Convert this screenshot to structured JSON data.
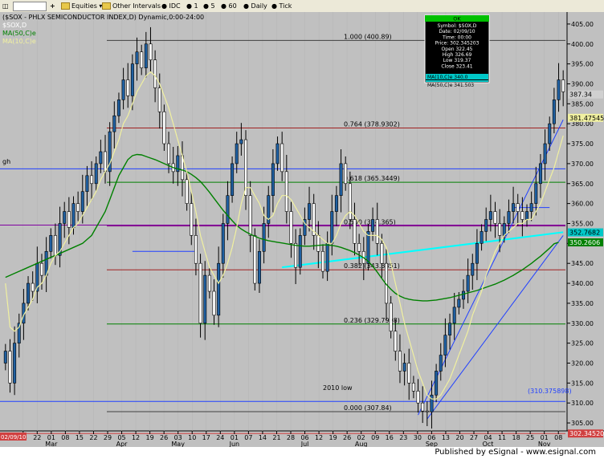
{
  "toolbar": {
    "save_icon": "floppy-icon",
    "symbol_box": "",
    "plus": "+",
    "equities": "Equities",
    "other_intervals": "Other Intervals",
    "idc": "IDC",
    "i1": "1",
    "i5": "5",
    "i60": "60",
    "daily": "Daily",
    "tick": "Tick"
  },
  "footer": {
    "published": "Published by eSignal - www.esignal.com"
  },
  "colors": {
    "bg": "#c0c0c0",
    "up": "#1f5fa0",
    "down": "#000000",
    "ma10": "#f0f0a0",
    "ma50": "#008000",
    "cyan": "#00ffff",
    "channel": "#2040ff"
  },
  "chart_data": {
    "type": "candlestick",
    "title": "($SOX - PHLX SEMICONDUCTOR INDEX,D) Dynamic,0:00-24:00",
    "legend": [
      {
        "label": "MA(50,C)e",
        "color": "#008000"
      },
      {
        "label": "MA(10,C)e",
        "color": "#f0f0a0"
      }
    ],
    "ylim": [
      303,
      408
    ],
    "y_ticks": [
      305,
      310,
      315,
      320,
      325,
      330,
      335,
      340,
      345,
      350,
      355,
      360,
      365,
      370,
      375,
      380,
      385,
      390,
      395,
      400,
      405
    ],
    "x_day_labels": [
      "15",
      "22",
      "01",
      "08",
      "15",
      "22",
      "29",
      "05",
      "12",
      "19",
      "26",
      "03",
      "10",
      "17",
      "24",
      "01",
      "07",
      "14",
      "21",
      "28",
      "06",
      "12",
      "19",
      "26",
      "02",
      "09",
      "16",
      "23",
      "30",
      "06",
      "13",
      "20",
      "27",
      "04",
      "11",
      "18",
      "25",
      "01",
      "08"
    ],
    "x_month_labels": [
      {
        "label": "Mar",
        "index": 2
      },
      {
        "label": "Apr",
        "index": 7
      },
      {
        "label": "May",
        "index": 11
      },
      {
        "label": "Jun",
        "index": 15
      },
      {
        "label": "Jul",
        "index": 20
      },
      {
        "label": "Aug",
        "index": 24
      },
      {
        "label": "Sep",
        "index": 29
      },
      {
        "label": "Oct",
        "index": 33
      },
      {
        "label": "Nov",
        "index": 37
      }
    ],
    "start_date_label": "02/09/10",
    "fib_levels": [
      {
        "label": "1.000 (400.89)",
        "value": 400.89,
        "color": "#404040"
      },
      {
        "label": "0.764 (378.9302)",
        "value": 378.93,
        "color": "#a02020"
      },
      {
        "label": "0.618 (365.3449)",
        "value": 365.34,
        "color": "#008000"
      },
      {
        "label": "0.500 (354.365)",
        "value": 354.37,
        "color": "#800080"
      },
      {
        "label": "0.382 (343.3851)",
        "value": 343.39,
        "color": "#a02020"
      },
      {
        "label": "0.236 (329.7998)",
        "value": 329.8,
        "color": "#008000"
      },
      {
        "label": "0.000 (307.84)",
        "value": 307.84,
        "color": "#404040"
      }
    ],
    "low_label": "2010 low",
    "low_value_label": "(310.375898)",
    "low_value": 310.38,
    "high_marker": "gh",
    "current_price_label": "302.345203",
    "price_labels": [
      {
        "label": "387.34",
        "value": 387.34,
        "color": "#d0d0d0",
        "text": "#000000"
      },
      {
        "label": "381.475454",
        "value": 381.48,
        "color": "#f0f0a0",
        "text": "#000000"
      },
      {
        "label": "352.7682",
        "value": 352.77,
        "color": "#00c8c8",
        "text": "#000000"
      },
      {
        "label": "350.2606",
        "value": 350.26,
        "color": "#008000",
        "text": "#ffffff"
      }
    ],
    "info_box": {
      "header": "OK",
      "rows": [
        "Symbol: $SOX,D",
        "Date: 02/09/10",
        "Time: 00:00",
        "Price: 302.345203",
        "Open 322.45",
        "High 326.69",
        "Low 319.37",
        "Close 323.41"
      ],
      "ma10": "MA(10,C)e 340.0",
      "ma50": "MA(50,C)e 341.503"
    },
    "closes": [
      323,
      315,
      325,
      330,
      335,
      340,
      338,
      345,
      342,
      348,
      352,
      347,
      355,
      358,
      354,
      360,
      358,
      363,
      367,
      365,
      370,
      373,
      368,
      378,
      382,
      386,
      391,
      387,
      395,
      398,
      394,
      400,
      396,
      389,
      383,
      375,
      370,
      368,
      372,
      366,
      360,
      352,
      345,
      330,
      342,
      338,
      332,
      345,
      355,
      362,
      370,
      375,
      376,
      362,
      352,
      340,
      348,
      355,
      362,
      370,
      375,
      368,
      358,
      350,
      344,
      352,
      356,
      360,
      352,
      348,
      343,
      350,
      358,
      362,
      370,
      365,
      356,
      350,
      348,
      345,
      353,
      356,
      350,
      345,
      335,
      328,
      323,
      318,
      320,
      315,
      313,
      310,
      308,
      307.8,
      312,
      318,
      322,
      327,
      330,
      334,
      336,
      338,
      342,
      345,
      350,
      353,
      356,
      358,
      355,
      352,
      355,
      358,
      360,
      358,
      356,
      358,
      360,
      365,
      370,
      375,
      380,
      386,
      391,
      388
    ],
    "ma10": [
      340,
      329,
      328,
      329,
      332,
      334,
      336,
      339,
      340,
      342,
      345,
      347,
      348,
      350,
      352,
      354,
      355,
      357,
      359,
      361,
      363,
      366,
      368,
      370,
      373,
      376,
      380,
      382,
      385,
      388,
      390,
      392,
      393,
      392,
      390,
      387,
      384,
      380,
      376,
      372,
      368,
      363,
      358,
      352,
      348,
      344,
      342,
      340,
      342,
      345,
      349,
      354,
      360,
      364,
      364,
      362,
      360,
      357,
      356,
      357,
      360,
      362,
      362,
      361,
      359,
      357,
      355,
      354,
      353,
      352,
      351,
      350,
      350,
      352,
      355,
      357,
      358,
      357,
      355,
      353,
      352,
      352,
      352,
      351,
      349,
      345,
      340,
      335,
      330,
      326,
      322,
      318,
      315,
      312,
      311,
      311,
      312,
      314,
      316,
      319,
      322,
      325,
      328,
      332,
      335,
      338,
      342,
      345,
      348,
      350,
      352,
      353,
      354,
      355,
      355,
      356,
      356,
      358,
      360,
      363,
      366,
      369,
      373,
      377
    ],
    "ma50": [
      341.5,
      342,
      342.5,
      343,
      343.5,
      344,
      344.5,
      345,
      345.5,
      346,
      346.5,
      347,
      347.5,
      348,
      348.5,
      349,
      349.5,
      350,
      351,
      352,
      354,
      356,
      358,
      361,
      364,
      367,
      369,
      371,
      372,
      372.3,
      372.2,
      371.8,
      371.4,
      371,
      370.5,
      370,
      369.5,
      369,
      368.7,
      368.4,
      368,
      367.3,
      366.5,
      365.5,
      364.2,
      362.8,
      361.3,
      359.8,
      358.3,
      357,
      355.7,
      354.5,
      353.6,
      352.9,
      352.3,
      351.8,
      351.3,
      351,
      350.7,
      350.5,
      350.3,
      350.1,
      349.9,
      349.7,
      349.5,
      349.4,
      349.3,
      349.3,
      349.4,
      349.5,
      349.6,
      349.6,
      349.5,
      349.3,
      349,
      348.6,
      348.2,
      347.7,
      347.1,
      346.4,
      345.5,
      344.3,
      342.8,
      341.2,
      339.7,
      338.5,
      337.5,
      336.8,
      336.3,
      336,
      335.8,
      335.7,
      335.6,
      335.6,
      335.7,
      335.8,
      336,
      336.2,
      336.4,
      336.7,
      337,
      337.3,
      337.6,
      337.9,
      338.2,
      338.6,
      339,
      339.4,
      339.8,
      340.3,
      340.8,
      341.4,
      342,
      342.7,
      343.4,
      344.2,
      345,
      345.9,
      346.8,
      347.8,
      348.8,
      349.9,
      350.3
    ],
    "cyan_segments": [
      {
        "x0": 61,
        "v0": 344,
        "x1": 123,
        "v1": 352.8
      }
    ],
    "blue_segments": [
      {
        "x0": 28,
        "v0": 348,
        "x1": 42,
        "v1": 348
      },
      {
        "x0": 112,
        "v0": 359,
        "x1": 120,
        "v1": 359
      },
      {
        "x0": 91,
        "v0": 307,
        "x1": 123,
        "v1": 381
      },
      {
        "x0": 93,
        "v0": 306,
        "x1": 123,
        "v1": 352
      }
    ]
  }
}
